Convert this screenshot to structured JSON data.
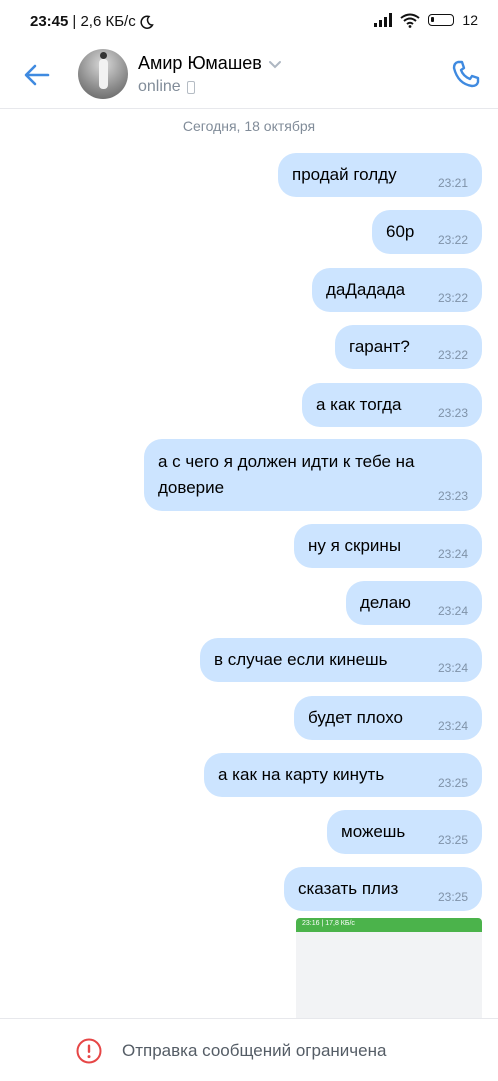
{
  "status_bar": {
    "time": "23:45",
    "speed": "| 2,6 КБ/с",
    "battery": "12"
  },
  "header": {
    "contact_name": "Амир Юмашев",
    "presence": "online"
  },
  "chat": {
    "date_divider": "Сегодня, 18 октября",
    "messages": [
      {
        "text": "продай голду",
        "time": "23:21"
      },
      {
        "text": "60р",
        "time": "23:22"
      },
      {
        "text": "даДадада",
        "time": "23:22"
      },
      {
        "text": "гарант?",
        "time": "23:22"
      },
      {
        "text": "а как тогда",
        "time": "23:23"
      },
      {
        "text": "а с чего я должен идти к тебе на",
        "text2": "доверие",
        "time": "23:23"
      },
      {
        "text": "ну я скрины",
        "time": "23:24"
      },
      {
        "text": "делаю",
        "time": "23:24"
      },
      {
        "text": "в случае если кинешь",
        "time": "23:24"
      },
      {
        "text": "будет плохо",
        "time": "23:24"
      },
      {
        "text": "а как на карту кинуть",
        "time": "23:25"
      },
      {
        "text": "можешь",
        "time": "23:25"
      },
      {
        "text": "сказать плиз",
        "time": "23:25"
      }
    ],
    "preview_statusbar_text": "23:16 | 17,8 КБ/с"
  },
  "footer": {
    "restriction_text": "Отправка сообщений ограничена"
  },
  "colors": {
    "accent": "#3f8ae0",
    "bubble_outgoing": "#cce4ff",
    "warning": "#e64646"
  },
  "icons": [
    "back-arrow-icon",
    "chevron-down-icon",
    "phone-icon",
    "mobile-device-icon",
    "warning-icon",
    "wifi-icon",
    "signal-icon",
    "moon-icon",
    "battery-icon"
  ]
}
